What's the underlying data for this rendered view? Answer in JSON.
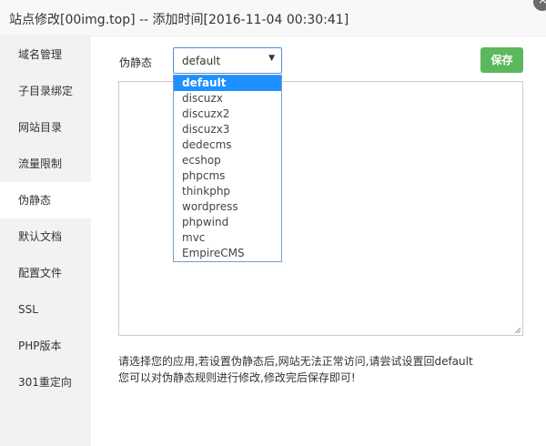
{
  "dialog": {
    "title": "站点修改[00img.top] -- 添加时间[2016-11-04 00:30:41]"
  },
  "sidebar": {
    "items": [
      {
        "label": "域名管理"
      },
      {
        "label": "子目录绑定"
      },
      {
        "label": "网站目录"
      },
      {
        "label": "流量限制"
      },
      {
        "label": "伪静态",
        "active": true
      },
      {
        "label": "默认文档"
      },
      {
        "label": "配置文件"
      },
      {
        "label": "SSL"
      },
      {
        "label": "PHP版本"
      },
      {
        "label": "301重定向"
      }
    ]
  },
  "rewrite": {
    "label": "伪静态",
    "selected": "default",
    "options": [
      "default",
      "discuzx",
      "discuzx2",
      "discuzx3",
      "dedecms",
      "ecshop",
      "phpcms",
      "thinkphp",
      "wordpress",
      "phpwind",
      "mvc",
      "EmpireCMS"
    ],
    "save_label": "保存",
    "editor_value": "",
    "hint_line1": "请选择您的应用,若设置伪静态后,网站无法正常访问,请尝试设置回default",
    "hint_line2": "您可以对伪静态规则进行修改,修改完后保存即可!"
  },
  "colors": {
    "save_button": "#5cb85c",
    "selected_option": "#1e90ff",
    "sidebar_bg": "#f2f2f2"
  }
}
